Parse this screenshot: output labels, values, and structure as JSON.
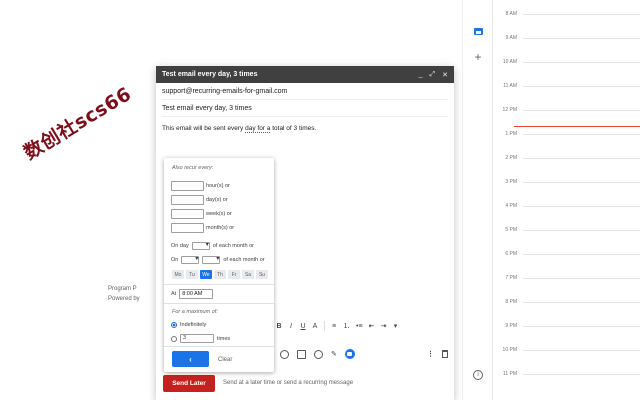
{
  "footer": {
    "line1": "Program P",
    "line2": "Powered by"
  },
  "watermark": {
    "text": "数创社scs66"
  },
  "compose": {
    "title": "Test email every day, 3 times",
    "header_icons": [
      "minimize-icon",
      "expand-icon",
      "close-icon"
    ],
    "header_glyphs": {
      "minimize": "_",
      "expand": "⤢",
      "close": "✕"
    },
    "to": "support@recurring-emails-for-gmail.com",
    "subject": "Test email every day, 3 times",
    "body_before": "This email will be sent every ",
    "body_day": "day",
    "body_mid": " ",
    "body_for": "for a",
    "body_after": " total of 3 times.",
    "send_later_label": "Send Later",
    "send_hint": "Send at a later time or send a recurring message",
    "format_toolbar": {
      "bold": "B",
      "italic": "I",
      "underline": "U",
      "text_color": "A",
      "align": "≡",
      "numbered_list": "⒈",
      "bulleted_list": "•≡",
      "indent_less": "⇤",
      "indent_more": "⇥",
      "more": "▾"
    },
    "actions": {
      "more_options": "⋮"
    }
  },
  "recurrence": {
    "also_recur_label": "Also recur every:",
    "hours_label": "hour(s) or",
    "days_label": "day(s) or",
    "weeks_label": "week(s) or",
    "months_label": "month(s) or",
    "on_day_label": "On day",
    "of_each_month_1": "of each month or",
    "on_label": "On",
    "of_each_month_2": "of each month or",
    "weekdays": [
      "Mo",
      "Tu",
      "We",
      "Th",
      "Fr",
      "Sa",
      "Su"
    ],
    "active_weekday": "We",
    "at_label": "At",
    "time_value": "8:00 AM",
    "max_label": "For a maximum of:",
    "indefinitely_label": "Indefinitely",
    "times_value": "3",
    "times_label": "times",
    "ok_glyph": "‹",
    "clear_label": "Clear"
  },
  "calendar": {
    "hours": [
      "8 AM",
      "9 AM",
      "10 AM",
      "11 AM",
      "12 PM",
      "1 PM",
      "2 PM",
      "3 PM",
      "4 PM",
      "5 PM",
      "6 PM",
      "7 PM",
      "8 PM",
      "9 PM",
      "10 PM",
      "11 PM"
    ]
  },
  "colors": {
    "send_later": "#c5221f",
    "accent": "#1a73e8",
    "current_time": "#ea4335",
    "header": "#404040"
  }
}
